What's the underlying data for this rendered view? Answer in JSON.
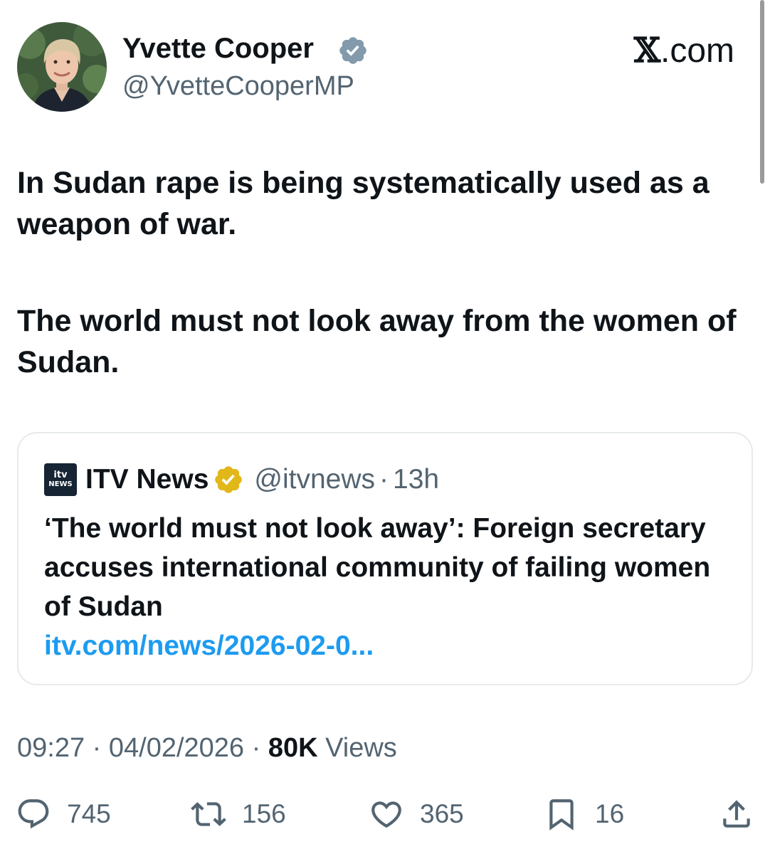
{
  "author": {
    "name": "Yvette Cooper",
    "handle": "@YvetteCooperMP",
    "verified_color": "#829aab"
  },
  "site_label": {
    "x": "𝕏",
    "domain": ".com"
  },
  "tweet": {
    "paragraphs": [
      "In Sudan rape is being systematically used as a weapon of war.",
      "The world must not look away from the women of Sudan."
    ]
  },
  "quote": {
    "logo": {
      "line1": "itv",
      "line2": "NEWS"
    },
    "name": "ITV News",
    "handle": "@itvnews",
    "separator": "·",
    "time": "13h",
    "headline": "‘The world must not look away’: Foreign secretary accuses international community of failing women of Sudan",
    "link": "itv.com/news/2026-02-0...",
    "badge_color": "#e2b719",
    "link_color": "#1d9bf0"
  },
  "meta": {
    "time": "09:27",
    "sep1": "·",
    "date": "04/02/2026",
    "sep2": "·",
    "views_count": "80K",
    "views_label": "Views"
  },
  "actions": {
    "replies": "745",
    "reposts": "156",
    "likes": "365",
    "bookmarks": "16",
    "icons": [
      "reply-icon",
      "repost-icon",
      "like-icon",
      "bookmark-icon",
      "share-icon"
    ]
  }
}
